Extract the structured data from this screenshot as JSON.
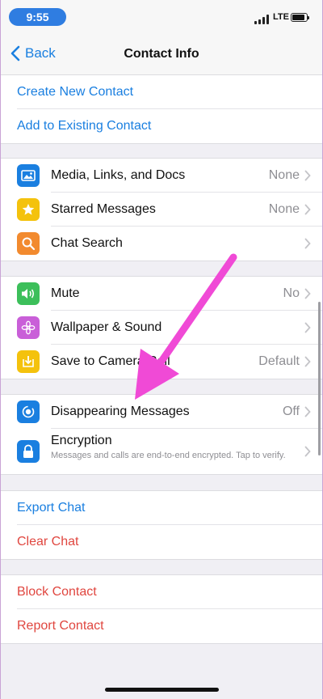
{
  "status": {
    "time": "9:55",
    "network": "LTE"
  },
  "nav": {
    "back_label": "Back",
    "title": "Contact Info"
  },
  "group1": {
    "create": "Create New Contact",
    "add": "Add to Existing Contact"
  },
  "group2": [
    {
      "label": "Media, Links, and Docs",
      "value": "None",
      "icon": "photo-icon"
    },
    {
      "label": "Starred Messages",
      "value": "None",
      "icon": "star-icon"
    },
    {
      "label": "Chat Search",
      "value": "",
      "icon": "search-icon"
    }
  ],
  "group3": [
    {
      "label": "Mute",
      "value": "No",
      "icon": "speaker-icon"
    },
    {
      "label": "Wallpaper & Sound",
      "value": "",
      "icon": "flower-icon"
    },
    {
      "label": "Save to Camera Roll",
      "value": "Default",
      "icon": "download-icon"
    }
  ],
  "group4": {
    "disappearing": {
      "label": "Disappearing Messages",
      "value": "Off"
    },
    "encryption": {
      "label": "Encryption",
      "sub": "Messages and calls are end-to-end encrypted. Tap to verify."
    }
  },
  "group5": {
    "export": "Export Chat",
    "clear": "Clear Chat"
  },
  "group6": {
    "block": "Block Contact",
    "report": "Report Contact"
  },
  "colors": {
    "accent": "#1a7fe0",
    "destructive": "#e0463f",
    "annotation": "#f04ad6"
  }
}
